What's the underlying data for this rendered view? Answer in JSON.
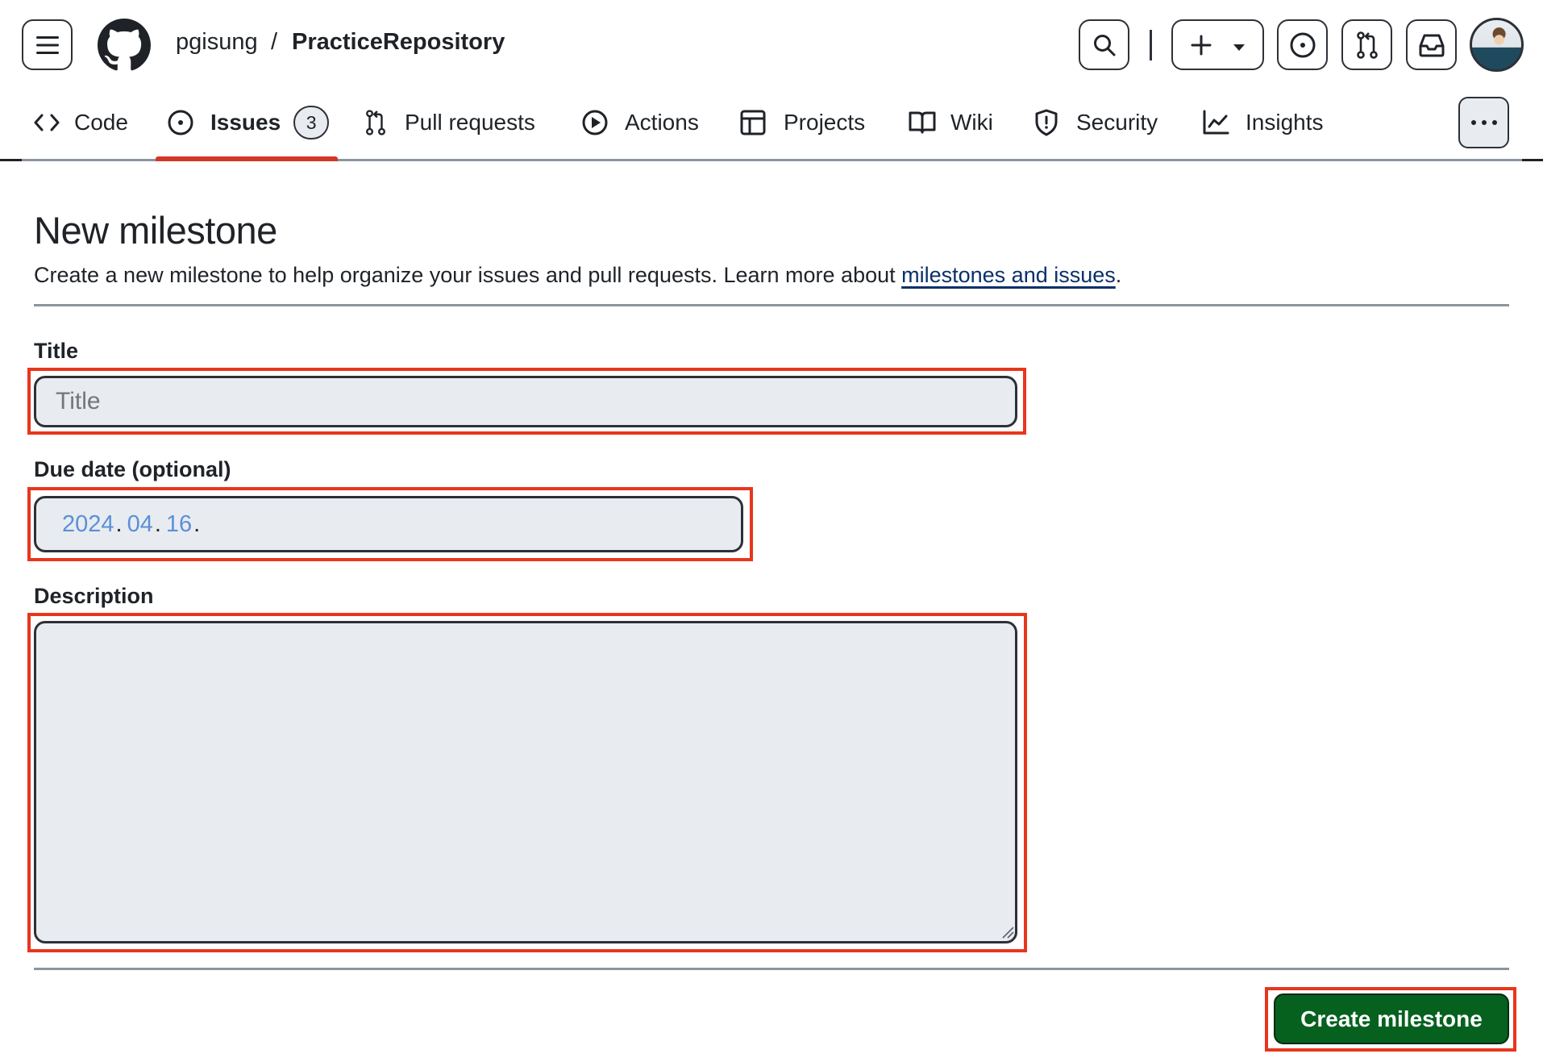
{
  "header": {
    "owner": "pgisung",
    "separator": "/",
    "repo": "PracticeRepository",
    "icons": {
      "menu": "hamburger-icon",
      "logo": "github-logo-icon",
      "search": "search-icon",
      "create": "plus-icon",
      "create_dropdown": "triangle-down-icon",
      "issues": "issue-opened-icon",
      "pulls": "git-pull-request-icon",
      "inbox": "inbox-icon",
      "avatar": "user-avatar"
    }
  },
  "nav": {
    "items": [
      {
        "label": "Code",
        "icon": "code-icon"
      },
      {
        "label": "Issues",
        "icon": "issue-opened-icon",
        "count": "3",
        "active": true
      },
      {
        "label": "Pull requests",
        "icon": "git-pull-request-icon"
      },
      {
        "label": "Actions",
        "icon": "play-icon"
      },
      {
        "label": "Projects",
        "icon": "table-icon"
      },
      {
        "label": "Wiki",
        "icon": "book-icon"
      },
      {
        "label": "Security",
        "icon": "shield-icon"
      },
      {
        "label": "Insights",
        "icon": "graph-icon"
      }
    ],
    "more_icon": "kebab-horizontal-icon"
  },
  "page": {
    "title": "New milestone",
    "subtitle_prefix": "Create a new milestone to help organize your issues and pull requests. Learn more about ",
    "subtitle_link": "milestones and issues",
    "subtitle_suffix": "."
  },
  "form": {
    "title_label": "Title",
    "title_placeholder": "Title",
    "due_label": "Due date (optional)",
    "due_date": {
      "year": "2024",
      "month": "04",
      "day": "16",
      "sep": "."
    },
    "description_label": "Description",
    "description_value": "",
    "submit_label": "Create milestone"
  },
  "colors": {
    "accent_active": "#d1382a",
    "link": "#0a3069",
    "primary_button": "#06611f",
    "highlight_box": "#e8361c",
    "input_bg": "#e8ecf0",
    "date_placeholder": "#5b8fd8"
  }
}
